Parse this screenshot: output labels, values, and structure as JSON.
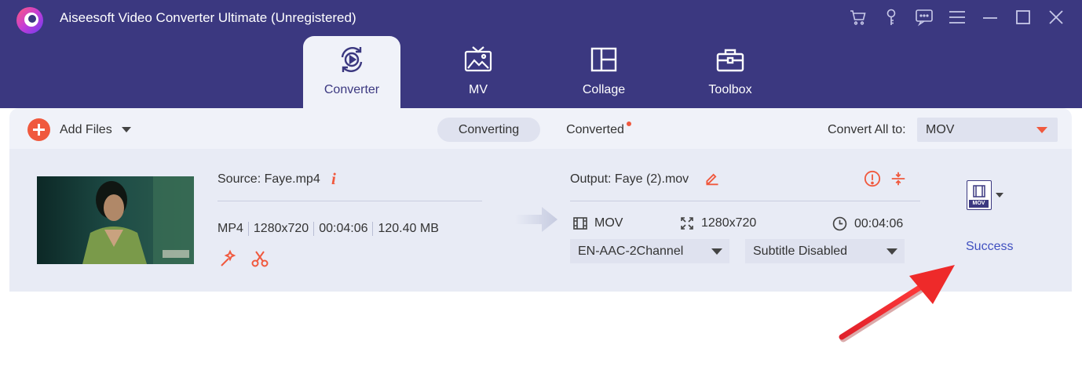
{
  "app": {
    "title": "Aiseesoft Video Converter Ultimate (Unregistered)",
    "accent_color": "#f0593e",
    "header_color": "#3b3880"
  },
  "window_controls": [
    {
      "name": "cart-icon"
    },
    {
      "name": "key-icon"
    },
    {
      "name": "chat-icon"
    },
    {
      "name": "menu-icon"
    },
    {
      "name": "minimize-icon"
    },
    {
      "name": "maximize-icon"
    },
    {
      "name": "close-icon"
    }
  ],
  "nav_tabs": [
    {
      "label": "Converter",
      "icon": "converter-icon",
      "active": true
    },
    {
      "label": "MV",
      "icon": "mv-icon",
      "active": false
    },
    {
      "label": "Collage",
      "icon": "collage-icon",
      "active": false
    },
    {
      "label": "Toolbox",
      "icon": "toolbox-icon",
      "active": false
    }
  ],
  "toolbar": {
    "add_files_label": "Add Files",
    "sub_tabs": [
      {
        "label": "Converting",
        "active": true
      },
      {
        "label": "Converted",
        "active": false,
        "has_notification": true
      }
    ],
    "convert_all_label": "Convert All to:",
    "convert_all_value": "MOV"
  },
  "file": {
    "source_label": "Source: Faye.mp4",
    "meta": [
      "MP4",
      "1280x720",
      "00:04:06",
      "120.40 MB"
    ],
    "output_label": "Output: Faye (2).mov",
    "output_format": "MOV",
    "output_resolution": "1280x720",
    "output_duration": "00:04:06",
    "audio_track": "EN-AAC-2Channel",
    "subtitle": "Subtitle Disabled",
    "status": "Success",
    "format_badge": "MOV"
  }
}
